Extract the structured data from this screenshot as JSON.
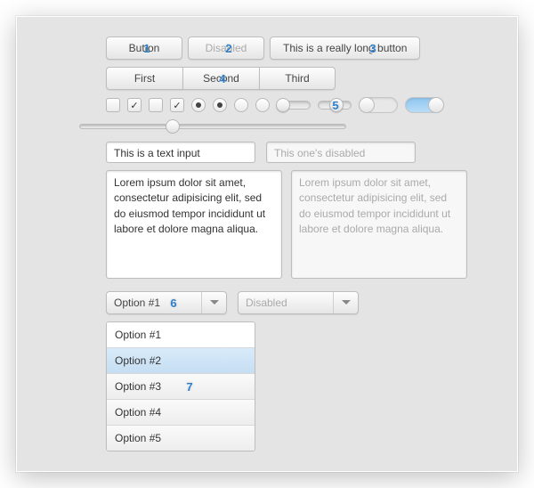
{
  "buttons": {
    "b1": "Button",
    "b2": "Disabled",
    "b3": "This is a really long button"
  },
  "segments": [
    "First",
    "Second",
    "Third"
  ],
  "checkboxes": [
    false,
    true,
    false,
    true
  ],
  "radios": [
    true,
    true,
    false,
    false
  ],
  "mini_sliders": [
    0.02,
    0.5
  ],
  "switches": [
    false,
    true
  ],
  "big_slider": 0.33,
  "text_input": {
    "value": "This is a text input",
    "disabled_placeholder": "This one's disabled"
  },
  "textarea": {
    "value": "Lorem ipsum dolor sit amet, consectetur adipisicing elit, sed do eiusmod tempor incididunt ut labore et dolore magna aliqua.",
    "disabled_value": "Lorem ipsum dolor sit amet, consectetur adipisicing elit, sed do eiusmod tempor incididunt ut labore et dolore magna aliqua."
  },
  "select": {
    "value": "Option #1",
    "disabled_value": "Disabled"
  },
  "listbox": {
    "items": [
      "Option #1",
      "Option #2",
      "Option #3",
      "Option #4",
      "Option #5"
    ],
    "selected": 1
  },
  "badges": [
    "1",
    "2",
    "3",
    "4",
    "5",
    "6",
    "7"
  ]
}
